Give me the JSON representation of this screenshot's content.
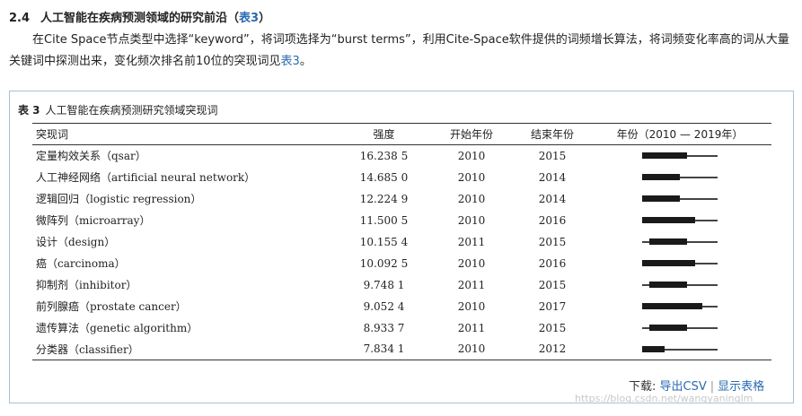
{
  "section": {
    "number": "2.4",
    "title_before": "人工智能在疾病预测领域的研究前沿（",
    "title_link": "表3",
    "title_after": "）"
  },
  "paragraph": {
    "text": "在Cite Space节点类型中选择“keyword”，将词项选择为“burst terms”，利用Cite-Space软件提供的词频增长算法，将词频变化率高的词从大量关键词中探测出来，变化频次排名前10位的突现词见",
    "link": "表3",
    "end": "。"
  },
  "table": {
    "caption_label": "表 3",
    "caption_text": "人工智能在疾病预测研究领域突现词",
    "headers": [
      "突现词",
      "强度",
      "开始年份",
      "结束年份",
      "年份（2010 — 2019年）"
    ],
    "timeline_range": [
      2010,
      2019
    ],
    "rows": [
      {
        "term": "定量构效关系（qsar）",
        "strength": "16.238 5",
        "start": "2010",
        "end": "2015"
      },
      {
        "term": "人工神经网络（artificial neural network）",
        "strength": "14.685 0",
        "start": "2010",
        "end": "2014"
      },
      {
        "term": "逻辑回归（logistic regression）",
        "strength": "12.224 9",
        "start": "2010",
        "end": "2014"
      },
      {
        "term": "微阵列（microarray）",
        "strength": "11.500 5",
        "start": "2010",
        "end": "2016"
      },
      {
        "term": "设计（design）",
        "strength": "10.155 4",
        "start": "2011",
        "end": "2015"
      },
      {
        "term": "癌（carcinoma）",
        "strength": "10.092 5",
        "start": "2010",
        "end": "2016"
      },
      {
        "term": "抑制剂（inhibitor）",
        "strength": "9.748 1",
        "start": "2011",
        "end": "2015"
      },
      {
        "term": "前列腺癌（prostate cancer）",
        "strength": "9.052 4",
        "start": "2010",
        "end": "2017"
      },
      {
        "term": "遗传算法（genetic algorithm）",
        "strength": "8.933 7",
        "start": "2011",
        "end": "2015"
      },
      {
        "term": "分类器（classifier）",
        "strength": "7.834 1",
        "start": "2010",
        "end": "2012"
      }
    ]
  },
  "footer": {
    "label": "下载:",
    "export_csv": "导出CSV",
    "separator": "|",
    "show_table": "显示表格"
  },
  "watermark": "https://blog.csdn.net/wangyaninglm"
}
